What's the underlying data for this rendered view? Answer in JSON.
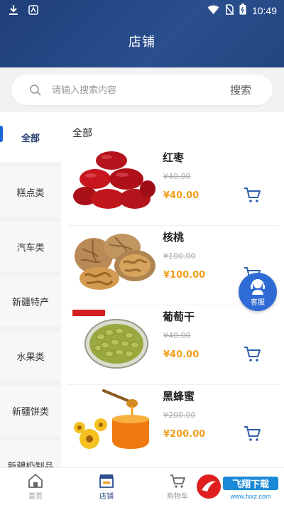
{
  "status_bar": {
    "time": "10:49"
  },
  "header": {
    "title": "店铺"
  },
  "search": {
    "placeholder": "请输入搜索内容",
    "button_label": "搜索"
  },
  "sidebar": {
    "items": [
      {
        "label": "全部",
        "active": true
      },
      {
        "label": "糕点类"
      },
      {
        "label": "汽车类"
      },
      {
        "label": "新疆特产"
      },
      {
        "label": "水果类"
      },
      {
        "label": "新疆饼类"
      },
      {
        "label": "新疆奶制品"
      }
    ]
  },
  "content": {
    "title": "全部",
    "products": [
      {
        "name": "红枣",
        "old_price": "¥40.00",
        "price": "¥40.00"
      },
      {
        "name": "核桃",
        "old_price": "¥100.00",
        "price": "¥100.00"
      },
      {
        "name": "葡萄干",
        "old_price": "¥40.00",
        "price": "¥40.00"
      },
      {
        "name": "黑蜂蜜",
        "old_price": "¥200.00",
        "price": "¥200.00"
      }
    ]
  },
  "float_button": {
    "label": "客服"
  },
  "bottom_nav": {
    "items": [
      {
        "label": "首页",
        "icon": "home-icon"
      },
      {
        "label": "店铺",
        "icon": "store-icon",
        "active": true
      },
      {
        "label": "购物车",
        "icon": "cart-icon"
      }
    ]
  },
  "watermark": {
    "text": "飞翔下载",
    "url": "www.fxxz.com"
  },
  "colors": {
    "header": "#2a4e8e",
    "price": "#f0a020",
    "accent": "#1a66d9"
  }
}
